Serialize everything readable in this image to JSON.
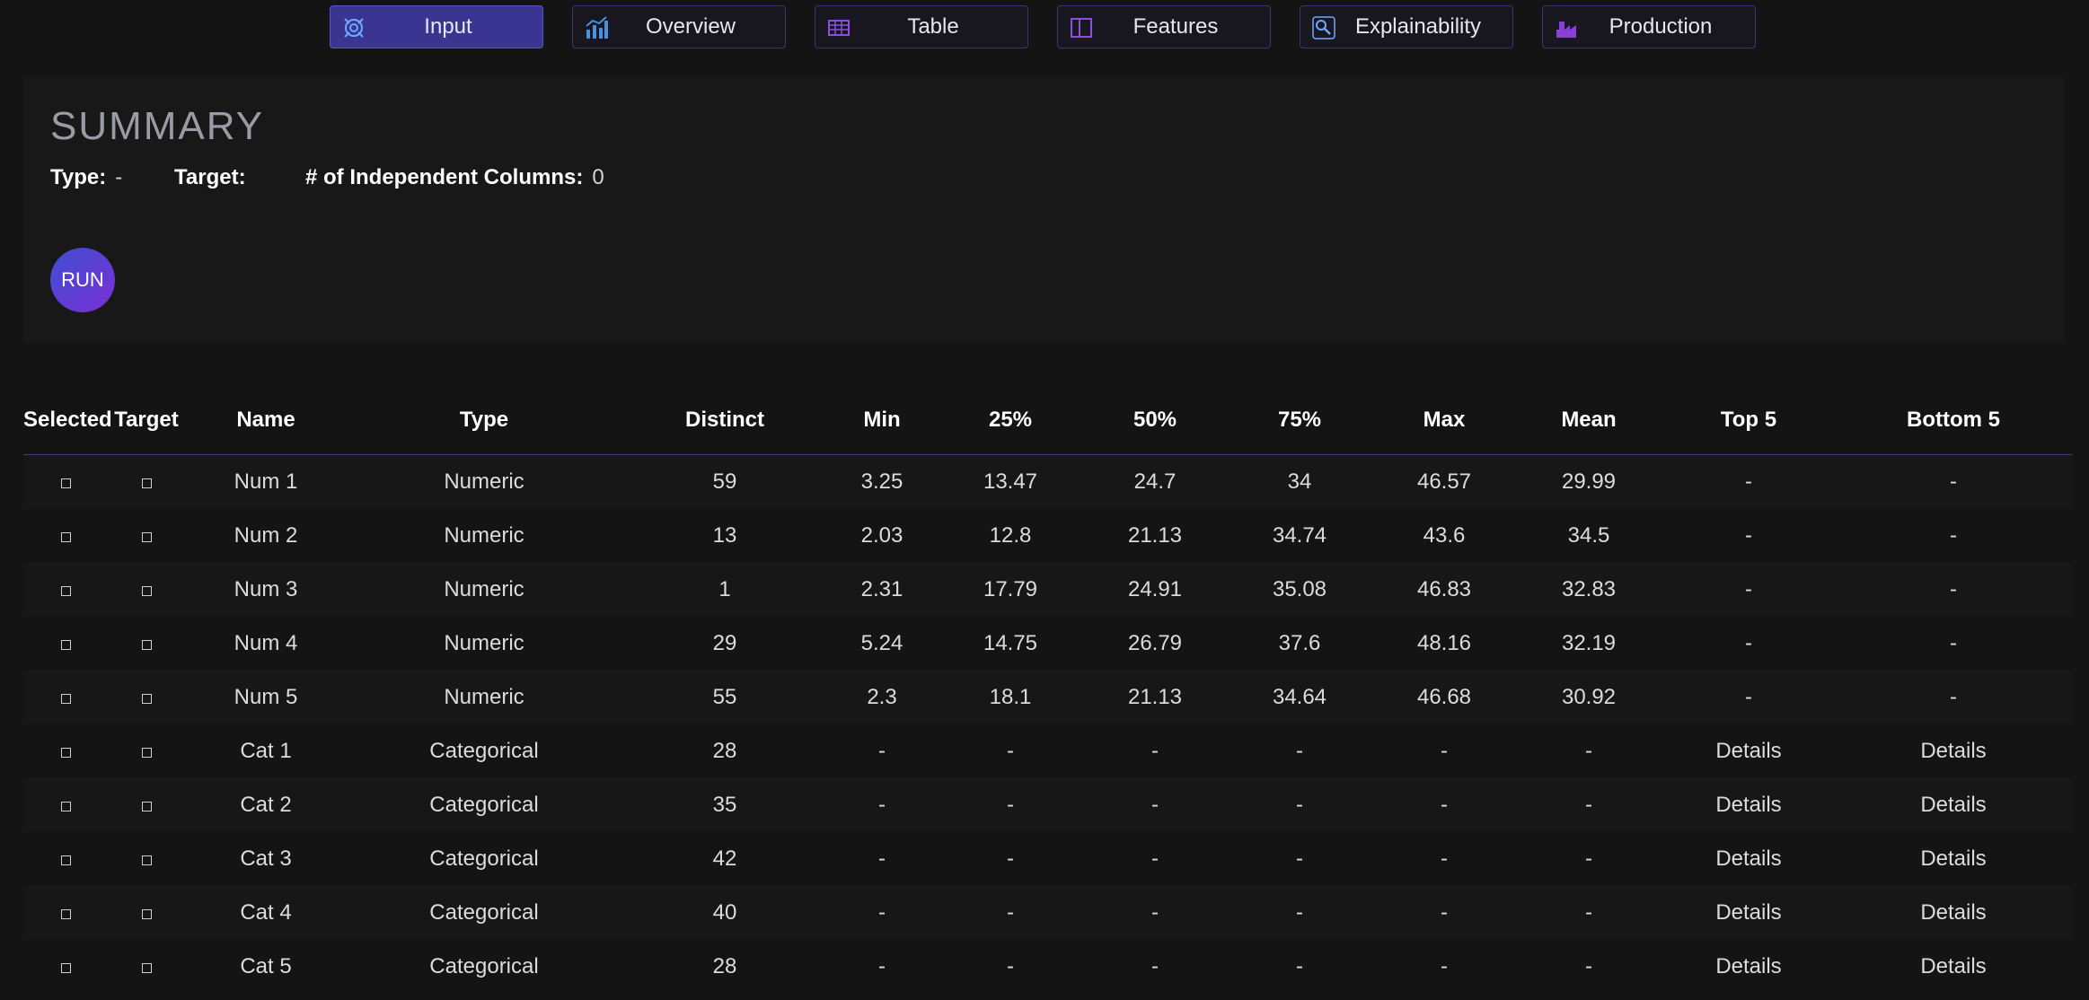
{
  "nav": {
    "tabs": [
      {
        "label": "Input",
        "icon": "network-icon",
        "active": true
      },
      {
        "label": "Overview",
        "icon": "bar-chart-icon",
        "active": false
      },
      {
        "label": "Table",
        "icon": "table-icon",
        "active": false
      },
      {
        "label": "Features",
        "icon": "columns-icon",
        "active": false
      },
      {
        "label": "Explainability",
        "icon": "magnifier-icon",
        "active": false
      },
      {
        "label": "Production",
        "icon": "factory-icon",
        "active": false
      }
    ]
  },
  "summary": {
    "title": "SUMMARY",
    "type_label": "Type:",
    "type_value": "-",
    "target_label": "Target:",
    "target_value": "",
    "indep_label": "# of Independent Columns:",
    "indep_value": "0",
    "run_label": "RUN"
  },
  "table": {
    "headers": [
      "Selected",
      "Target",
      "Name",
      "Type",
      "Distinct",
      "Min",
      "25%",
      "50%",
      "75%",
      "Max",
      "Mean",
      "Top 5",
      "Bottom 5"
    ],
    "rows": [
      {
        "name": "Num 1",
        "type": "Numeric",
        "distinct": "59",
        "min": "3.25",
        "p25": "13.47",
        "p50": "24.7",
        "p75": "34",
        "max": "46.57",
        "mean": "29.99",
        "top5": "-",
        "bottom5": "-"
      },
      {
        "name": "Num 2",
        "type": "Numeric",
        "distinct": "13",
        "min": "2.03",
        "p25": "12.8",
        "p50": "21.13",
        "p75": "34.74",
        "max": "43.6",
        "mean": "34.5",
        "top5": "-",
        "bottom5": "-"
      },
      {
        "name": "Num 3",
        "type": "Numeric",
        "distinct": "1",
        "min": "2.31",
        "p25": "17.79",
        "p50": "24.91",
        "p75": "35.08",
        "max": "46.83",
        "mean": "32.83",
        "top5": "-",
        "bottom5": "-"
      },
      {
        "name": "Num 4",
        "type": "Numeric",
        "distinct": "29",
        "min": "5.24",
        "p25": "14.75",
        "p50": "26.79",
        "p75": "37.6",
        "max": "48.16",
        "mean": "32.19",
        "top5": "-",
        "bottom5": "-"
      },
      {
        "name": "Num 5",
        "type": "Numeric",
        "distinct": "55",
        "min": "2.3",
        "p25": "18.1",
        "p50": "21.13",
        "p75": "34.64",
        "max": "46.68",
        "mean": "30.92",
        "top5": "-",
        "bottom5": "-"
      },
      {
        "name": "Cat 1",
        "type": "Categorical",
        "distinct": "28",
        "min": "-",
        "p25": "-",
        "p50": "-",
        "p75": "-",
        "max": "-",
        "mean": "-",
        "top5": "Details",
        "bottom5": "Details"
      },
      {
        "name": "Cat 2",
        "type": "Categorical",
        "distinct": "35",
        "min": "-",
        "p25": "-",
        "p50": "-",
        "p75": "-",
        "max": "-",
        "mean": "-",
        "top5": "Details",
        "bottom5": "Details"
      },
      {
        "name": "Cat 3",
        "type": "Categorical",
        "distinct": "42",
        "min": "-",
        "p25": "-",
        "p50": "-",
        "p75": "-",
        "max": "-",
        "mean": "-",
        "top5": "Details",
        "bottom5": "Details"
      },
      {
        "name": "Cat 4",
        "type": "Categorical",
        "distinct": "40",
        "min": "-",
        "p25": "-",
        "p50": "-",
        "p75": "-",
        "max": "-",
        "mean": "-",
        "top5": "Details",
        "bottom5": "Details"
      },
      {
        "name": "Cat 5",
        "type": "Categorical",
        "distinct": "28",
        "min": "-",
        "p25": "-",
        "p50": "-",
        "p75": "-",
        "max": "-",
        "mean": "-",
        "top5": "Details",
        "bottom5": "Details"
      }
    ]
  },
  "colors": {
    "accent": "#3a3591",
    "run_start": "#3d4fd0",
    "run_end": "#7a2fd6",
    "background": "#151414"
  }
}
